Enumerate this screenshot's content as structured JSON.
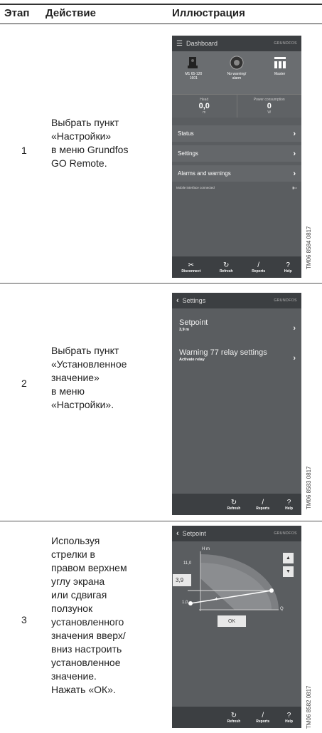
{
  "header": {
    "col_step": "Этап",
    "col_action": "Действие",
    "col_illustration": "Иллюстрация"
  },
  "rows": [
    {
      "step": "1",
      "action": "Выбрать пункт\n«Настройки»\nв меню Grundfos\nGO Remote.",
      "tm": "TM06 8584 0817",
      "screen": {
        "title": "Dashboard",
        "brand": "GRUNDFOS",
        "pump_label": "M1 65-120\n1601",
        "status_label": "No warning/\nalarm",
        "master_label": "Master",
        "head_key": "Head",
        "head_value": "0,0",
        "head_unit": "m",
        "power_key": "Power consumption",
        "power_value": "0",
        "power_unit": "W",
        "menu": [
          "Status",
          "Settings",
          "Alarms and warnings"
        ],
        "mobile_text": "Mobile interface connected",
        "bottom": [
          "Disconnect",
          "Refresh",
          "Reports",
          "Help"
        ]
      }
    },
    {
      "step": "2",
      "action": "Выбрать пункт\n«Установленное\nзначение»\nв меню\n«Настройки».",
      "tm": "TM06 8583 0817",
      "screen": {
        "title": "Settings",
        "brand": "GRUNDFOS",
        "items": [
          {
            "title": "Setpoint",
            "sub": "3,9 m"
          },
          {
            "title": "Warning 77 relay settings",
            "sub": "Activate relay"
          }
        ],
        "bottom": [
          "Refresh",
          "Reports",
          "Help"
        ]
      }
    },
    {
      "step": "3",
      "action": "Используя\nстрелки в\nправом верхнем\nуглу экрана\nили сдвигая\nползунок\nустановленного\nзначения вверх/\nвниз настроить\nустановленное\nзначение.\nНажать «ОК».",
      "tm": "TM06 8582 0817",
      "screen": {
        "title": "Setpoint",
        "brand": "GRUNDFOS",
        "axis_y": "H m",
        "axis_x": "Q",
        "tick_max": "11,0",
        "tick_min": "1,0",
        "value": "3,9",
        "ok": "OK",
        "bottom": [
          "Refresh",
          "Reports",
          "Help"
        ]
      }
    }
  ]
}
